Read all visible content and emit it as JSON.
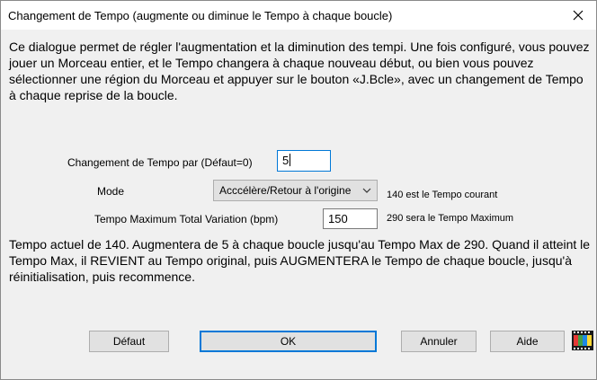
{
  "window": {
    "title": "Changement de Tempo (augmente ou diminue le Tempo à chaque boucle)",
    "close_icon": "close-icon"
  },
  "intro_text": "Ce dialogue permet de régler l'augmentation et la diminution des tempi. Une fois configuré, vous pouvez jouer un Morceau entier, et le Tempo changera à chaque nouveau début, ou bien vous pouvez sélectionner une région du Morceau et appuyer sur le bouton «J.Bcle», avec un changement de Tempo à chaque reprise de la boucle.",
  "tempo_change": {
    "label": "Changement de Tempo par (Défaut=0)",
    "value": "5"
  },
  "mode": {
    "label": "Mode",
    "selected": "Acccélère/Retour à l'origine",
    "current_tempo_note": "140 est le Tempo courant"
  },
  "max_variation": {
    "label": "Tempo Maximum Total Variation (bpm)",
    "value": "150",
    "max_tempo_note": "290 sera le Tempo Maximum"
  },
  "summary_text": "Tempo actuel de 140. Augmentera de 5 à chaque boucle jusqu'au Tempo Max de 290. Quand il atteint le Tempo Max, il REVIENT au Tempo original, puis AUGMENTERA  le Tempo de chaque boucle, jusqu'à réinitialisation, puis recommence.",
  "buttons": {
    "default": "Défaut",
    "ok": "OK",
    "cancel": "Annuler",
    "help": "Aide"
  },
  "icons": {
    "close": "close-icon",
    "dropdown": "chevron-down-icon",
    "film": "film-icon"
  },
  "colors": {
    "accent": "#0078d7",
    "dialog_bg": "#f0f0f0",
    "button_bg": "#e1e1e1"
  }
}
